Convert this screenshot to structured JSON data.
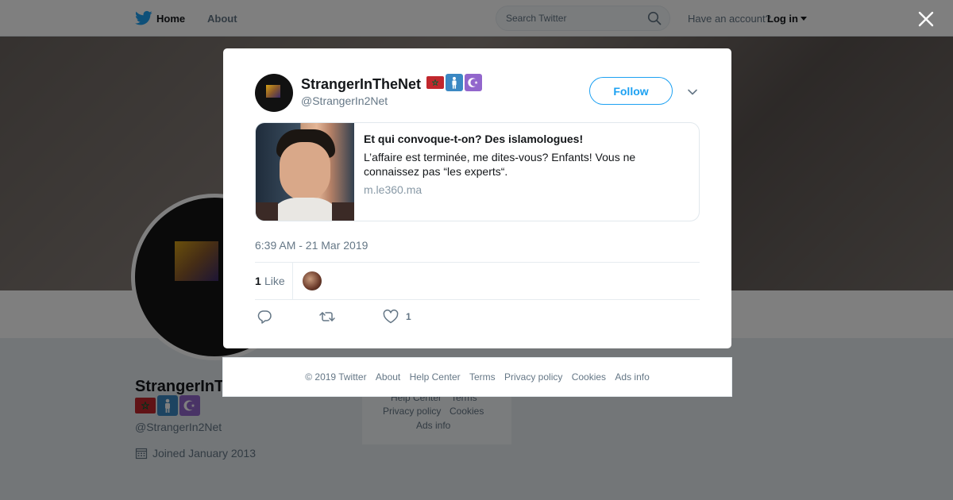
{
  "nav": {
    "home": "Home",
    "about": "About",
    "search_placeholder": "Search Twitter",
    "have_account": "Have an account?",
    "login": "Log in"
  },
  "profile": {
    "name": "StrangerInT",
    "handle": "@StrangerIn2Net",
    "joined": "Joined January 2013",
    "flags": [
      "morocco-flag-emoji",
      "person-sign-emoji",
      "star-and-crescent-emoji"
    ]
  },
  "side_footer": {
    "links": [
      "Help Center",
      "Terms",
      "Privacy policy",
      "Cookies",
      "Ads info"
    ]
  },
  "tweet": {
    "author_name": "StrangerInTheNet",
    "author_handle": "@StrangerIn2Net",
    "follow_label": "Follow",
    "card": {
      "title": "Et qui convoque-t-on? Des islamologues!",
      "description": "L’affaire est terminée, me dites-vous? Enfants! Vous ne connaissez pas “les experts“.",
      "domain": "m.le360.ma"
    },
    "timestamp": "6:39 AM - 21 Mar 2019",
    "likes_count": "1",
    "likes_label": "Like",
    "action_like_count": "1"
  },
  "footer": {
    "copyright": "© 2019 Twitter",
    "links": [
      "About",
      "Help Center",
      "Terms",
      "Privacy policy",
      "Cookies",
      "Ads info"
    ]
  },
  "colors": {
    "brand": "#1da1f2",
    "text_primary": "#14171a",
    "text_secondary": "#657786",
    "overlay": "rgba(0,0,0,0.5)",
    "morocco_red": "#c1272d",
    "sign_blue": "#3b88c3",
    "purple": "#9266cc"
  }
}
